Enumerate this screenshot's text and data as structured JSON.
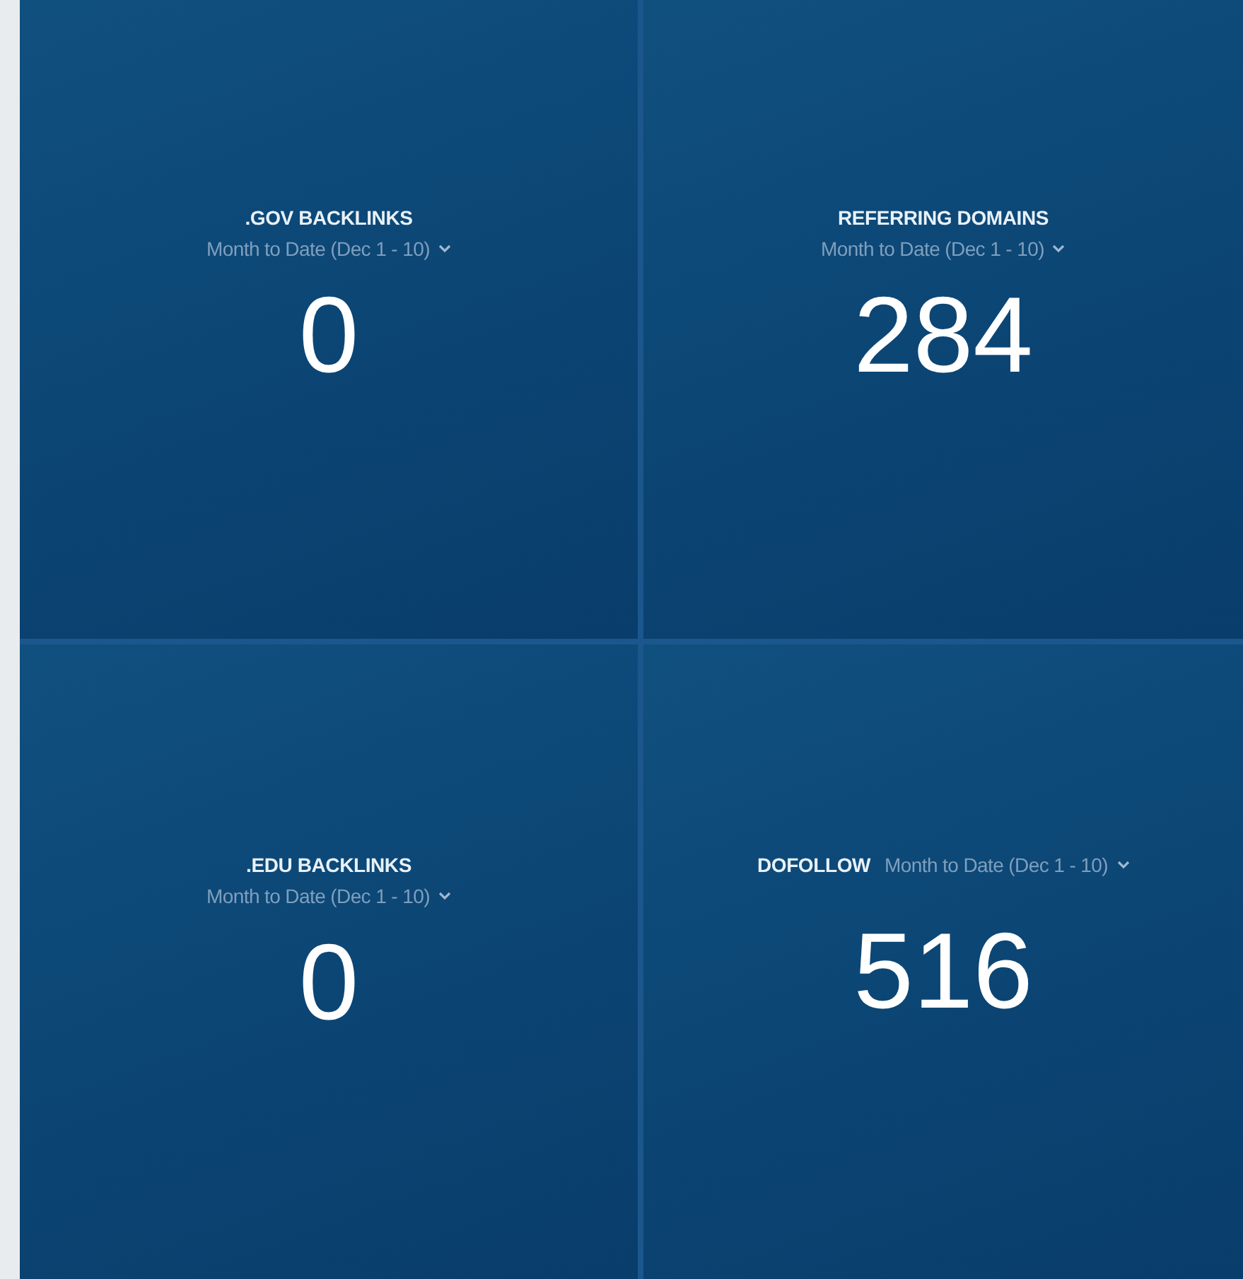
{
  "tiles": [
    {
      "title": ".GOV BACKLINKS",
      "period": "Month to Date (Dec 1 - 10)",
      "value": "0",
      "kind": "stacked"
    },
    {
      "title": "REFERRING DOMAINS",
      "period": "Month to Date (Dec 1 - 10)",
      "value": "284",
      "kind": "stacked"
    },
    {
      "title": ".EDU BACKLINKS",
      "period": "Month to Date (Dec 1 - 10)",
      "value": "0",
      "kind": "stacked"
    },
    {
      "title": "DOFOLLOW",
      "period": "Month to Date (Dec 1 - 10)",
      "value": "516",
      "kind": "inline"
    }
  ]
}
